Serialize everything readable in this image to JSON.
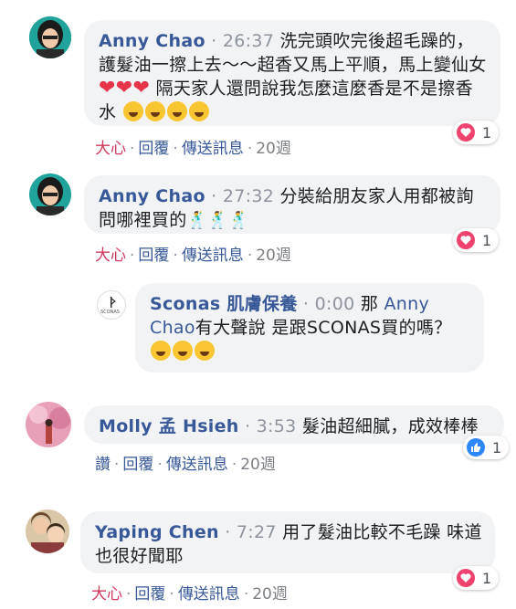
{
  "comments": [
    {
      "author": "Anny Chao",
      "time": "26:37",
      "text1": "洗完頭吹完後超毛躁的，護髮油一擦上去～～超香又馬上平順，馬上變仙女",
      "hearts": "❤❤❤",
      "text2": " 隔天家人還問說我怎麼這麼香是不是擦香水",
      "actions": {
        "react": "大心",
        "reply": "回覆",
        "message": "傳送訊息",
        "age": "20週"
      },
      "reaction": {
        "icon": "heart-icon",
        "count": "1"
      }
    },
    {
      "author": "Anny Chao",
      "time": "27:32",
      "text1": "分裝給朋友家人用都被詢問哪裡買的",
      "dancers": "🕺🕺🕺",
      "actions": {
        "react": "大心",
        "reply": "回覆",
        "message": "傳送訊息",
        "age": "20週"
      },
      "reaction": {
        "icon": "heart-icon",
        "count": "1"
      }
    },
    {
      "author": "Sconas 肌膚保養",
      "time": "0:00",
      "text_a": "那 ",
      "mention": "Anny Chao",
      "text_b": "有大聲說 是跟SCONAS買的嗎？",
      "avatar_text": "SCONAS"
    },
    {
      "author": "Molly 孟 Hsieh",
      "time": "3:53",
      "text1": "髮油超細膩，成效棒棒",
      "actions": {
        "react": "讚",
        "reply": "回覆",
        "message": "傳送訊息",
        "age": "20週"
      },
      "reaction": {
        "icon": "like-icon",
        "count": "1"
      }
    },
    {
      "author": "Yaping Chen",
      "time": "7:27",
      "text1": "用了髮油比較不毛躁 味道也很好聞耶",
      "actions": {
        "react": "大心",
        "reply": "回覆",
        "message": "傳送訊息",
        "age": "20週"
      },
      "reaction": {
        "icon": "heart-icon",
        "count": "1"
      }
    }
  ],
  "colors": {
    "author": "#385898",
    "love": "#d0385d",
    "bubble": "#f2f3f5",
    "heart": "#f0426e",
    "like": "#2d88ff"
  }
}
